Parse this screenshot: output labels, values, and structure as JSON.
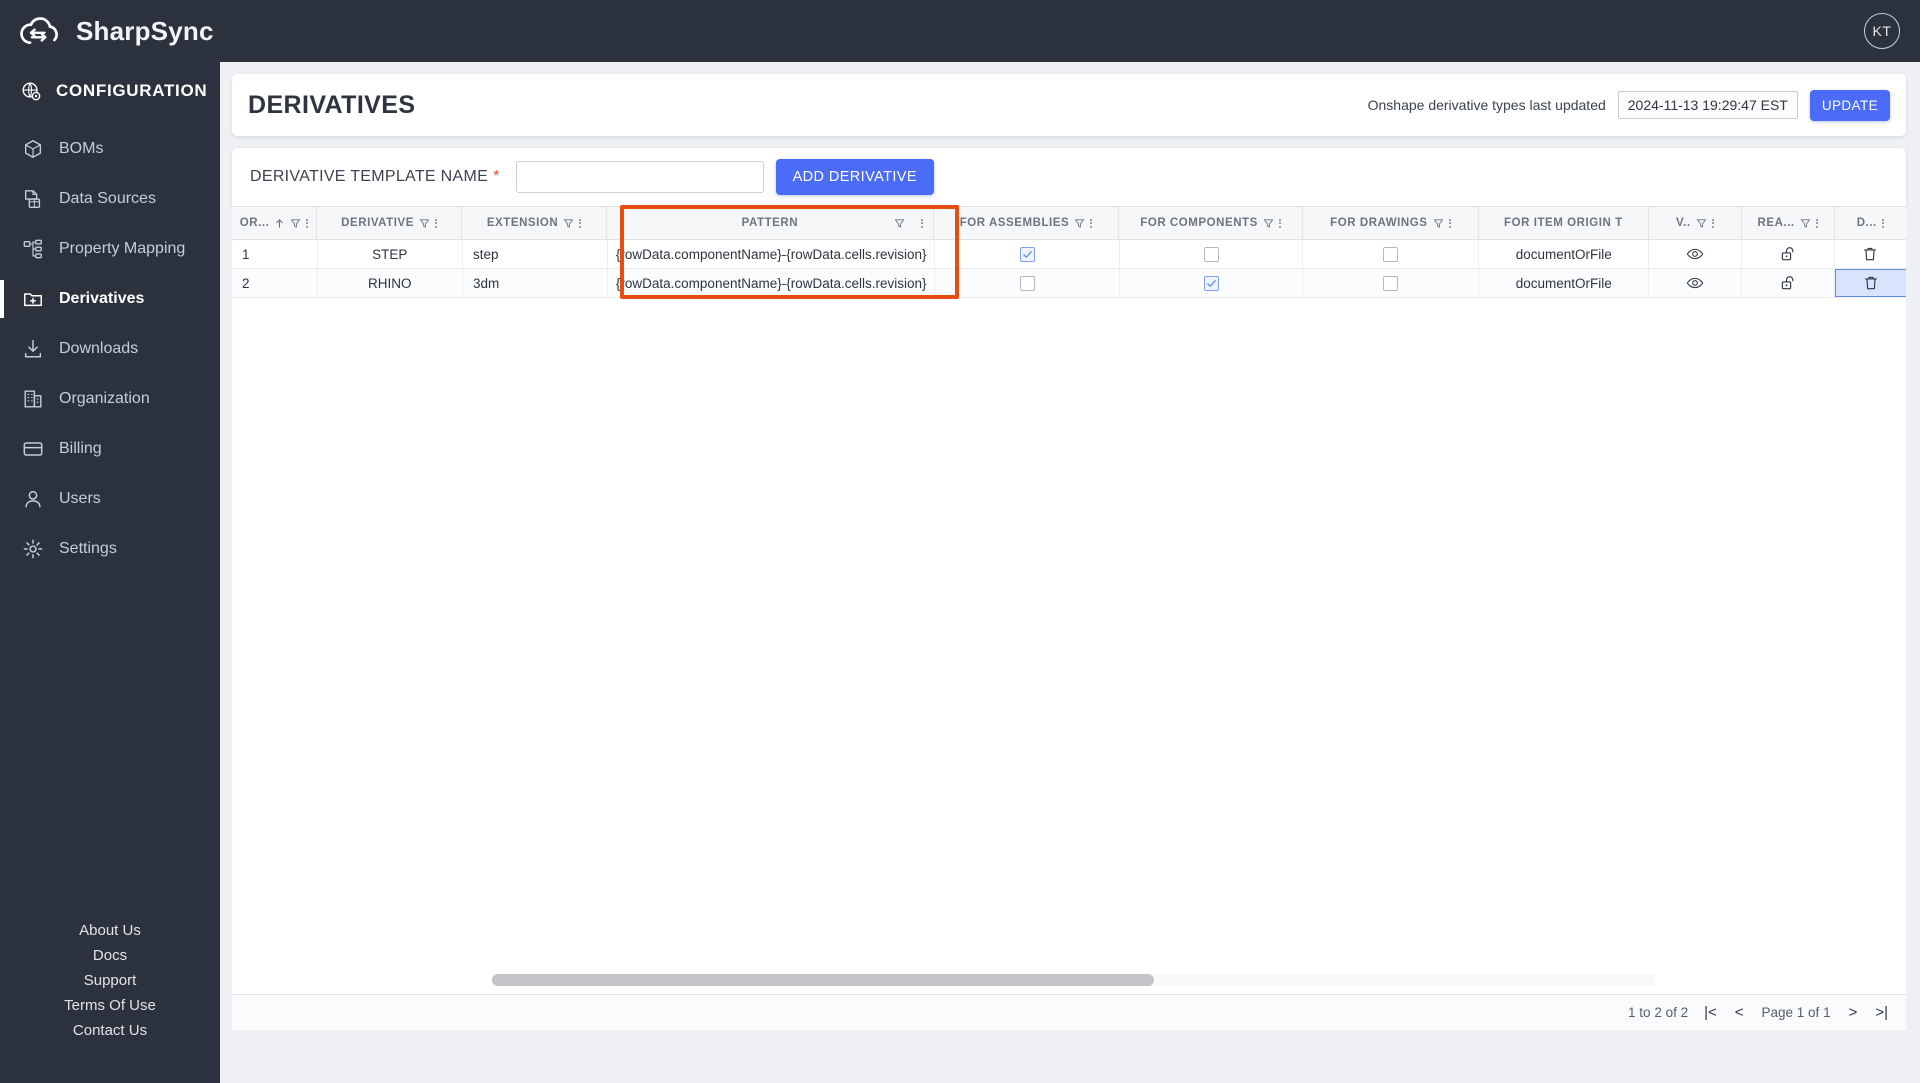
{
  "app": {
    "brand": "SharpSync",
    "logo_icon": "cloud-sync-icon",
    "avatar_initials": "KT"
  },
  "sidebar": {
    "section_label": "CONFIGURATION",
    "section_icon": "globe-gear-icon",
    "items": [
      {
        "label": "BOMs",
        "icon": "cube-icon",
        "active": false
      },
      {
        "label": "Data Sources",
        "icon": "database-file-icon",
        "active": false
      },
      {
        "label": "Property Mapping",
        "icon": "sitemap-icon",
        "active": false
      },
      {
        "label": "Derivatives",
        "icon": "folder-plus-icon",
        "active": true
      },
      {
        "label": "Downloads",
        "icon": "download-icon",
        "active": false
      },
      {
        "label": "Organization",
        "icon": "building-icon",
        "active": false
      },
      {
        "label": "Billing",
        "icon": "credit-card-icon",
        "active": false
      },
      {
        "label": "Users",
        "icon": "user-icon",
        "active": false
      },
      {
        "label": "Settings",
        "icon": "gear-icon",
        "active": false
      }
    ],
    "footer_links": [
      "About Us",
      "Docs",
      "Support",
      "Terms Of Use",
      "Contact Us"
    ]
  },
  "header": {
    "title": "DERIVATIVES",
    "update_note": "Onshape derivative types last updated",
    "last_updated": "2024-11-13 19:29:47 EST",
    "update_button": "UPDATE"
  },
  "form": {
    "label": "DERIVATIVE TEMPLATE NAME",
    "required_mark": "*",
    "input_value": "",
    "input_placeholder": "",
    "add_button": "ADD DERIVATIVE"
  },
  "grid": {
    "columns": [
      {
        "key": "order",
        "label": "OR...",
        "sortable": true,
        "filter": true,
        "menu": true
      },
      {
        "key": "derivative",
        "label": "DERIVATIVE",
        "sortable": false,
        "filter": true,
        "menu": true
      },
      {
        "key": "extension",
        "label": "EXTENSION",
        "sortable": false,
        "filter": true,
        "menu": true
      },
      {
        "key": "pattern",
        "label": "PATTERN",
        "sortable": false,
        "filter": true,
        "menu": true
      },
      {
        "key": "assemblies",
        "label": "FOR ASSEMBLIES",
        "sortable": false,
        "filter": true,
        "menu": true
      },
      {
        "key": "components",
        "label": "FOR COMPONENTS",
        "sortable": false,
        "filter": true,
        "menu": true
      },
      {
        "key": "drawings",
        "label": "FOR DRAWINGS",
        "sortable": false,
        "filter": true,
        "menu": true
      },
      {
        "key": "item_origin",
        "label": "FOR ITEM ORIGIN T",
        "sortable": false,
        "filter": false,
        "menu": false
      },
      {
        "key": "view",
        "label": "V..",
        "sortable": false,
        "filter": true,
        "menu": true
      },
      {
        "key": "readonly",
        "label": "REA...",
        "sortable": false,
        "filter": true,
        "menu": true
      },
      {
        "key": "delete",
        "label": "D...",
        "sortable": false,
        "filter": false,
        "menu": true
      }
    ],
    "rows": [
      {
        "order": "1",
        "derivative": "STEP",
        "extension": "step",
        "pattern": "{rowData.componentName}-{rowData.cells.revision}",
        "assemblies": true,
        "components": false,
        "drawings": false,
        "item_origin": "documentOrFile",
        "view_icon": "eye-icon",
        "readonly_icon": "unlock-icon",
        "delete_icon": "trash-icon",
        "delete_selected": false
      },
      {
        "order": "2",
        "derivative": "RHINO",
        "extension": "3dm",
        "pattern": "{rowData.componentName}-{rowData.cells.revision}",
        "assemblies": false,
        "components": true,
        "drawings": false,
        "item_origin": "documentOrFile",
        "view_icon": "eye-icon",
        "readonly_icon": "unlock-icon",
        "delete_icon": "trash-icon",
        "delete_selected": true
      }
    ],
    "highlight_color": "#e84d10",
    "highlighted_column": "PATTERN"
  },
  "pagination": {
    "range_text": "1 to 2 of 2",
    "page_text": "Page 1 of 1",
    "first_icon": "first-page-icon",
    "prev_icon": "prev-page-icon",
    "next_icon": "next-page-icon",
    "last_icon": "last-page-icon"
  },
  "colors": {
    "sidebar_bg": "#2b323e",
    "accent": "#4a6cf7",
    "highlight": "#e84d10",
    "required": "#e2503b"
  }
}
